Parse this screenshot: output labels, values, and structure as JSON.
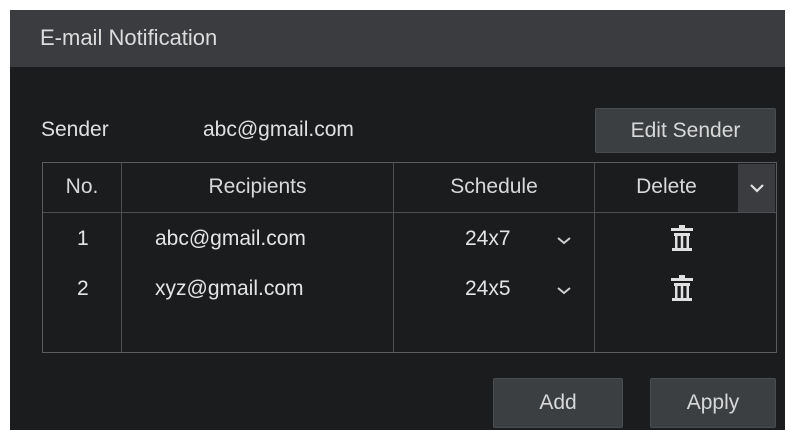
{
  "dialog": {
    "title": "E-mail Notification"
  },
  "sender": {
    "label": "Sender",
    "value": "abc@gmail.com",
    "edit_button": "Edit Sender"
  },
  "table": {
    "columns": [
      "No.",
      "Recipients",
      "Schedule",
      "Delete"
    ],
    "rows": [
      {
        "no": "1",
        "recipient": "abc@gmail.com",
        "schedule": "24x7"
      },
      {
        "no": "2",
        "recipient": "xyz@gmail.com",
        "schedule": "24x5"
      }
    ]
  },
  "footer": {
    "add_button": "Add",
    "apply_button": "Apply"
  },
  "icons": {
    "delete": "trash-icon",
    "schedule_dropdown": "chevron-down-icon",
    "column_menu": "chevron-down-icon"
  },
  "colors": {
    "panel_bg": "#1b1c1e",
    "titlebar_bg": "#3a3c3f",
    "button_bg": "#3c3f42",
    "text": "#d8d8d8",
    "grid_line": "#4c4e51"
  }
}
